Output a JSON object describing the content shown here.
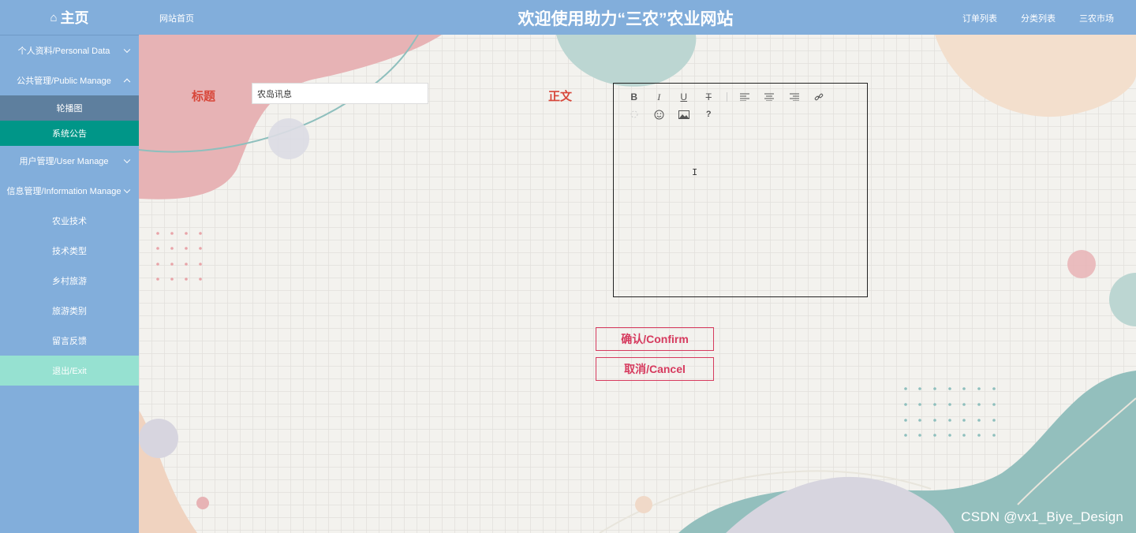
{
  "header": {
    "home_icon": "home-icon",
    "home_label": "主页",
    "site_home_link": "网站首页",
    "site_title": "欢迎使用助力“三农”农业网站",
    "links": [
      "订单列表",
      "分类列表",
      "三农市场"
    ]
  },
  "sidebar": {
    "personal": "个人资料/Personal Data",
    "public": "公共管理/Public Manage",
    "public_sub": [
      "轮播图",
      "系统公告"
    ],
    "user": "用户管理/User Manage",
    "info": "信息管理/Information Manage",
    "info_sub": [
      "农业技术",
      "技术类型",
      "乡村旅游",
      "旅游类别",
      "留言反馈"
    ],
    "exit": "退出/Exit"
  },
  "form": {
    "title_label": "标题",
    "title_value": "农岛讯息",
    "body_label": "正文",
    "confirm": "确认/Confirm",
    "cancel": "取消/Cancel"
  },
  "editor_toolbar": [
    "bold",
    "italic",
    "underline",
    "strikethrough",
    "align-left",
    "align-center",
    "align-right",
    "link",
    "unlink",
    "emoji",
    "image",
    "help"
  ],
  "watermark": "CSDN @vx1_Biye_Design",
  "colors": {
    "header": "#82aedb",
    "active_sub": "#009688",
    "exit": "#96e1d1",
    "label": "#d8473a",
    "button": "#d63a5e"
  }
}
